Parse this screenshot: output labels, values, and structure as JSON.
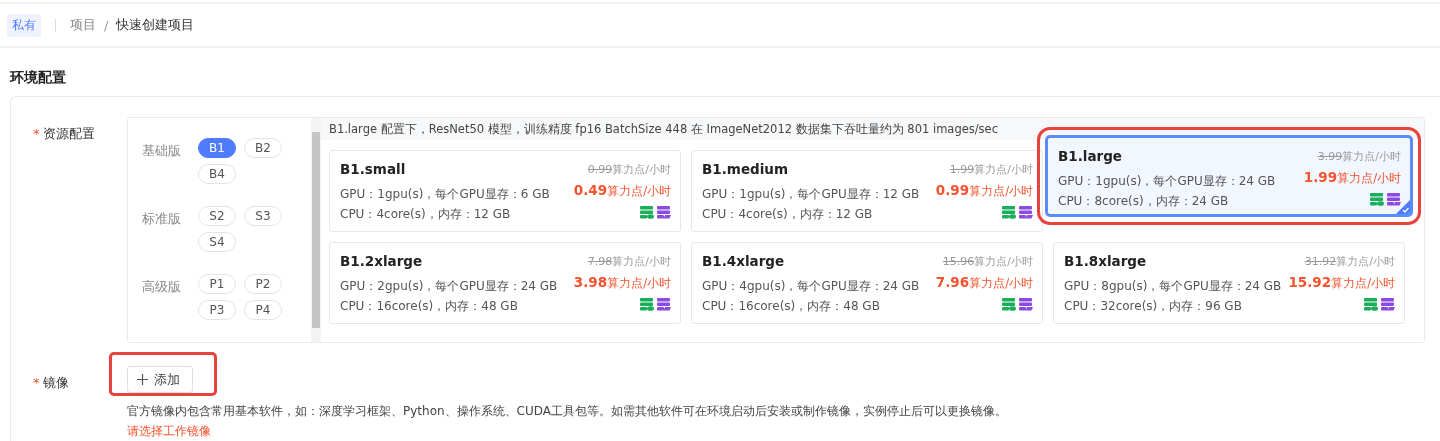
{
  "breadcrumb": {
    "tag": "私有",
    "items": [
      "项目",
      "快速创建项目"
    ],
    "separators": [
      "/"
    ]
  },
  "section_title": "环境配置",
  "resource": {
    "label": "资源配置",
    "required": true,
    "required_mark": "*",
    "tiers": [
      {
        "name": "基础版",
        "options": [
          {
            "label": "B1",
            "selected": true
          },
          {
            "label": "B2",
            "selected": false
          },
          {
            "label": "B4",
            "selected": false
          }
        ]
      },
      {
        "name": "标准版",
        "options": [
          {
            "label": "S2",
            "selected": false
          },
          {
            "label": "S3",
            "selected": false
          },
          {
            "label": "S4",
            "selected": false
          }
        ]
      },
      {
        "name": "高级版",
        "options": [
          {
            "label": "P1",
            "selected": false
          },
          {
            "label": "P2",
            "selected": false
          },
          {
            "label": "P3",
            "selected": false
          },
          {
            "label": "P4",
            "selected": false
          }
        ]
      }
    ],
    "info": "B1.large 配置下，ResNet50 模型，训练精度 fp16 BatchSize 448 在 ImageNet2012 数据集下吞吐量约为 801 images/sec",
    "specs": [
      {
        "name": "B1.small",
        "original_price": "0.99",
        "original_unit": "算力点/小时",
        "price": "0.49",
        "unit": "算力点/小时",
        "gpu": "GPU：1gpu(s)，每个GPU显存：6 GB",
        "cpu": "CPU：4core(s)，内存：12 GB",
        "selected": false,
        "highlighted": false
      },
      {
        "name": "B1.medium",
        "original_price": "1.99",
        "original_unit": "算力点/小时",
        "price": "0.99",
        "unit": "算力点/小时",
        "gpu": "GPU：1gpu(s)，每个GPU显存：12 GB",
        "cpu": "CPU：4core(s)，内存：12 GB",
        "selected": false,
        "highlighted": false
      },
      {
        "name": "B1.large",
        "original_price": "3.99",
        "original_unit": "算力点/小时",
        "price": "1.99",
        "unit": "算力点/小时",
        "gpu": "GPU：1gpu(s)，每个GPU显存：24 GB",
        "cpu": "CPU：8core(s)，内存：24 GB",
        "selected": true,
        "highlighted": true
      },
      {
        "name": "B1.2xlarge",
        "original_price": "7.98",
        "original_unit": "算力点/小时",
        "price": "3.98",
        "unit": "算力点/小时",
        "gpu": "GPU：2gpu(s)，每个GPU显存：24 GB",
        "cpu": "CPU：16core(s)，内存：48 GB",
        "selected": false,
        "highlighted": false
      },
      {
        "name": "B1.4xlarge",
        "original_price": "15.96",
        "original_unit": "算力点/小时",
        "price": "7.96",
        "unit": "算力点/小时",
        "gpu": "GPU：4gpu(s)，每个GPU显存：24 GB",
        "cpu": "CPU：16core(s)，内存：48 GB",
        "selected": false,
        "highlighted": false
      },
      {
        "name": "B1.8xlarge",
        "original_price": "31.92",
        "original_unit": "算力点/小时",
        "price": "15.92",
        "unit": "算力点/小时",
        "gpu": "GPU：8gpu(s)，每个GPU显存：24 GB",
        "cpu": "CPU：32core(s)，内存：96 GB",
        "selected": false,
        "highlighted": false
      }
    ]
  },
  "image": {
    "label": "镜像",
    "required": true,
    "required_mark": "*",
    "add_button": "添加",
    "add_highlighted": true,
    "description": "官方镜像内包含常用基本软件，如：深度学习框架、Python、操作系统、CUDA工具包等。如需其他软件可在环境启动后安装或制作镜像，实例停止后可以更换镜像。",
    "error": "请选择工作镜像"
  }
}
